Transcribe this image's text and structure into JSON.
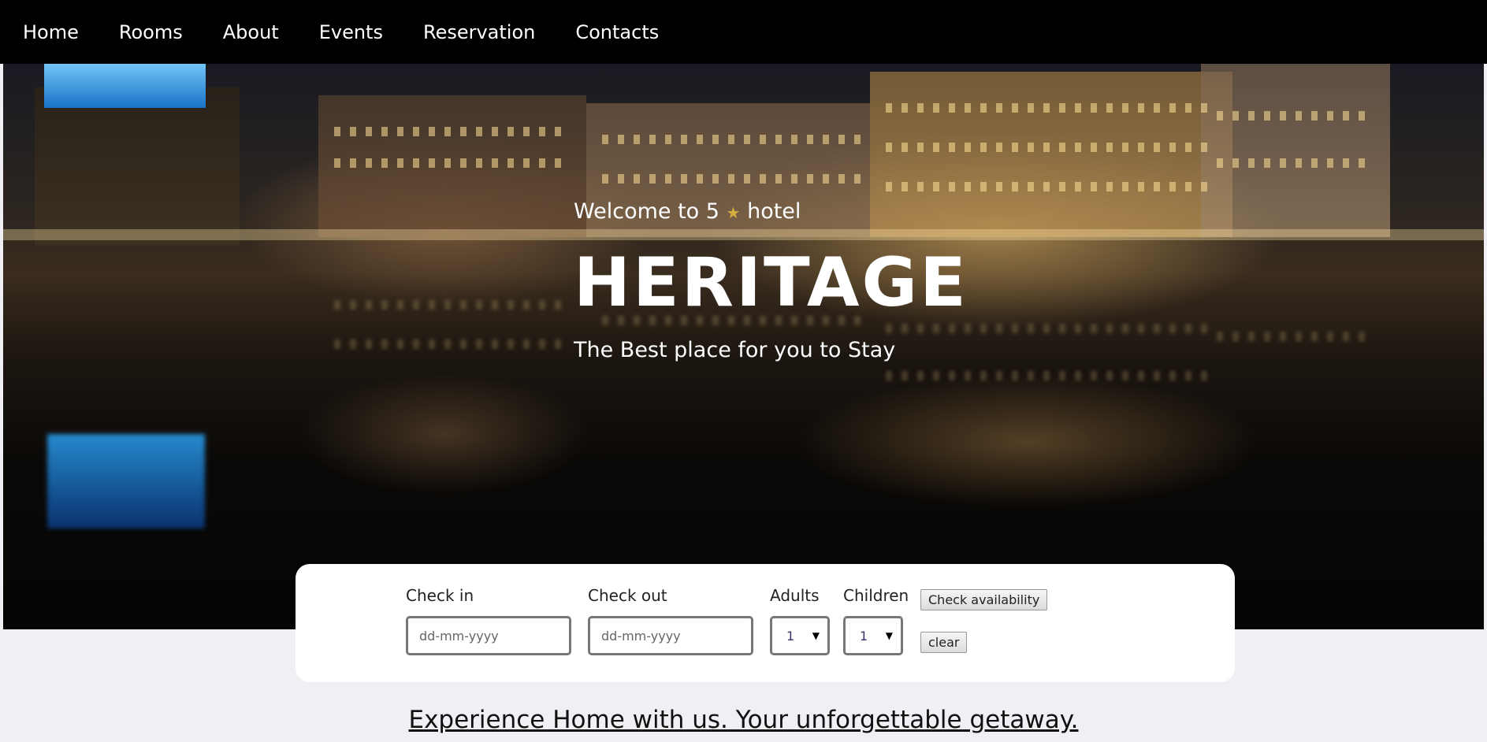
{
  "nav": {
    "items": [
      {
        "label": "Home"
      },
      {
        "label": "Rooms"
      },
      {
        "label": "About"
      },
      {
        "label": "Events"
      },
      {
        "label": "Reservation"
      },
      {
        "label": "Contacts"
      }
    ]
  },
  "hero": {
    "welcome_prefix": "Welcome to 5",
    "star_icon": "★",
    "welcome_suffix": "hotel",
    "title": "HERITAGE",
    "tagline": "The Best place for you to Stay"
  },
  "booking": {
    "check_in_label": "Check in",
    "check_in_placeholder": "dd-mm-yyyy",
    "check_out_label": "Check out",
    "check_out_placeholder": "dd-mm-yyyy",
    "adults_label": "Adults",
    "adults_value": "1",
    "children_label": "Children",
    "children_value": "1",
    "check_availability_label": "Check availability",
    "clear_label": "clear"
  },
  "tagline_link": "Experience Home with us. Your unforgettable getaway.",
  "colors": {
    "nav_bg": "#000000",
    "page_bg": "#efeff4",
    "star": "#d4b03e"
  }
}
